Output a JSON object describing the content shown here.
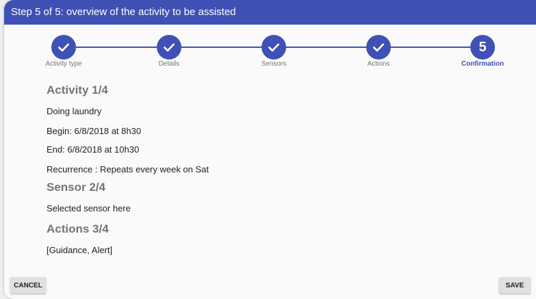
{
  "dialog": {
    "title": "Step 5 of 5: overview of the activity to be assisted"
  },
  "stepper": {
    "steps": [
      {
        "label": "Activity type",
        "state": "done"
      },
      {
        "label": "Details",
        "state": "done"
      },
      {
        "label": "Sensors",
        "state": "done"
      },
      {
        "label": "Actions",
        "state": "done"
      },
      {
        "label": "Confirmation",
        "state": "active",
        "number": "5"
      }
    ]
  },
  "summary": {
    "activity": {
      "title": "Activity 1/4",
      "name": "Doing laundry",
      "begin": "Begin: 6/8/2018 at 8h30",
      "end": "End: 6/8/2018 at 10h30",
      "recurrence": "Recurrence : Repeats every week on Sat"
    },
    "sensor": {
      "title": "Sensor 2/4",
      "value": "Selected sensor here"
    },
    "actions": {
      "title": "Actions 3/4",
      "value": "[Guidance, Alert]"
    }
  },
  "buttons": {
    "cancel": "CANCEL",
    "save": "SAVE"
  },
  "colors": {
    "primary": "#3f51b5",
    "section_title": "#757575",
    "button_bg": "#e0e0e0"
  }
}
